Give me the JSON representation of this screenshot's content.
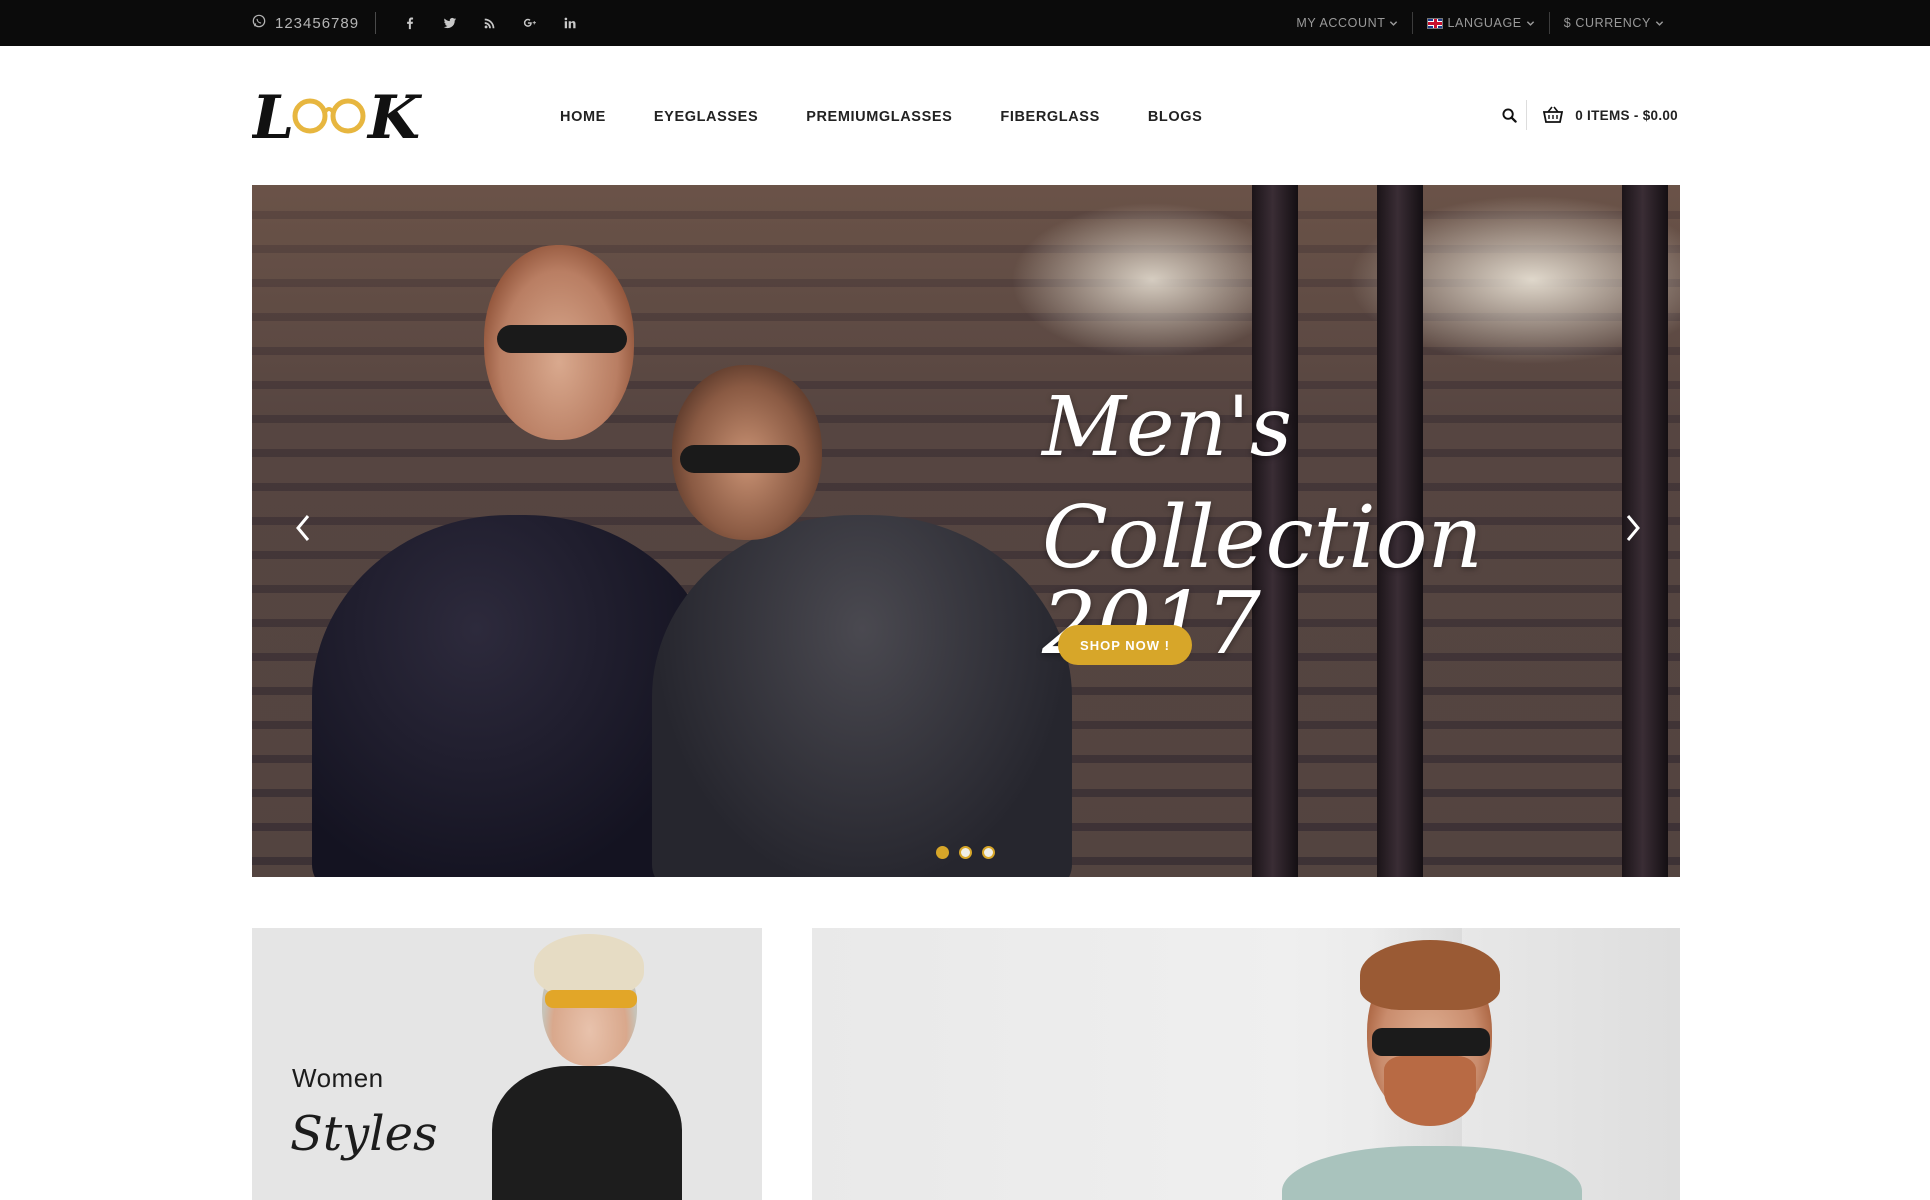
{
  "topbar": {
    "phone": "123456789",
    "socials": [
      "facebook-icon",
      "twitter-icon",
      "rss-icon",
      "google-plus-icon",
      "linkedin-icon"
    ],
    "my_account": "MY ACCOUNT",
    "language": "LANGUAGE",
    "currency": "$ CURRENCY"
  },
  "header": {
    "logo_text": "LOOK",
    "nav": [
      "HOME",
      "EYEGLASSES",
      "PREMIUMGLASSES",
      "FIBERGLASS",
      "BLOGS"
    ],
    "cart_label": "0 ITEMS - $0.00"
  },
  "hero": {
    "title_line1": "Men's",
    "title_line2": "Collection 2017",
    "button_label": "SHOP NOW !",
    "slide_count": 3,
    "active_slide": 1
  },
  "banners": {
    "women_small": "Women",
    "women_large": "Styles"
  },
  "colors": {
    "topbar_bg": "#0b0b0b",
    "accent": "#d7a629",
    "text_dark": "#222222",
    "banner_bg": "#e5e5e5"
  }
}
